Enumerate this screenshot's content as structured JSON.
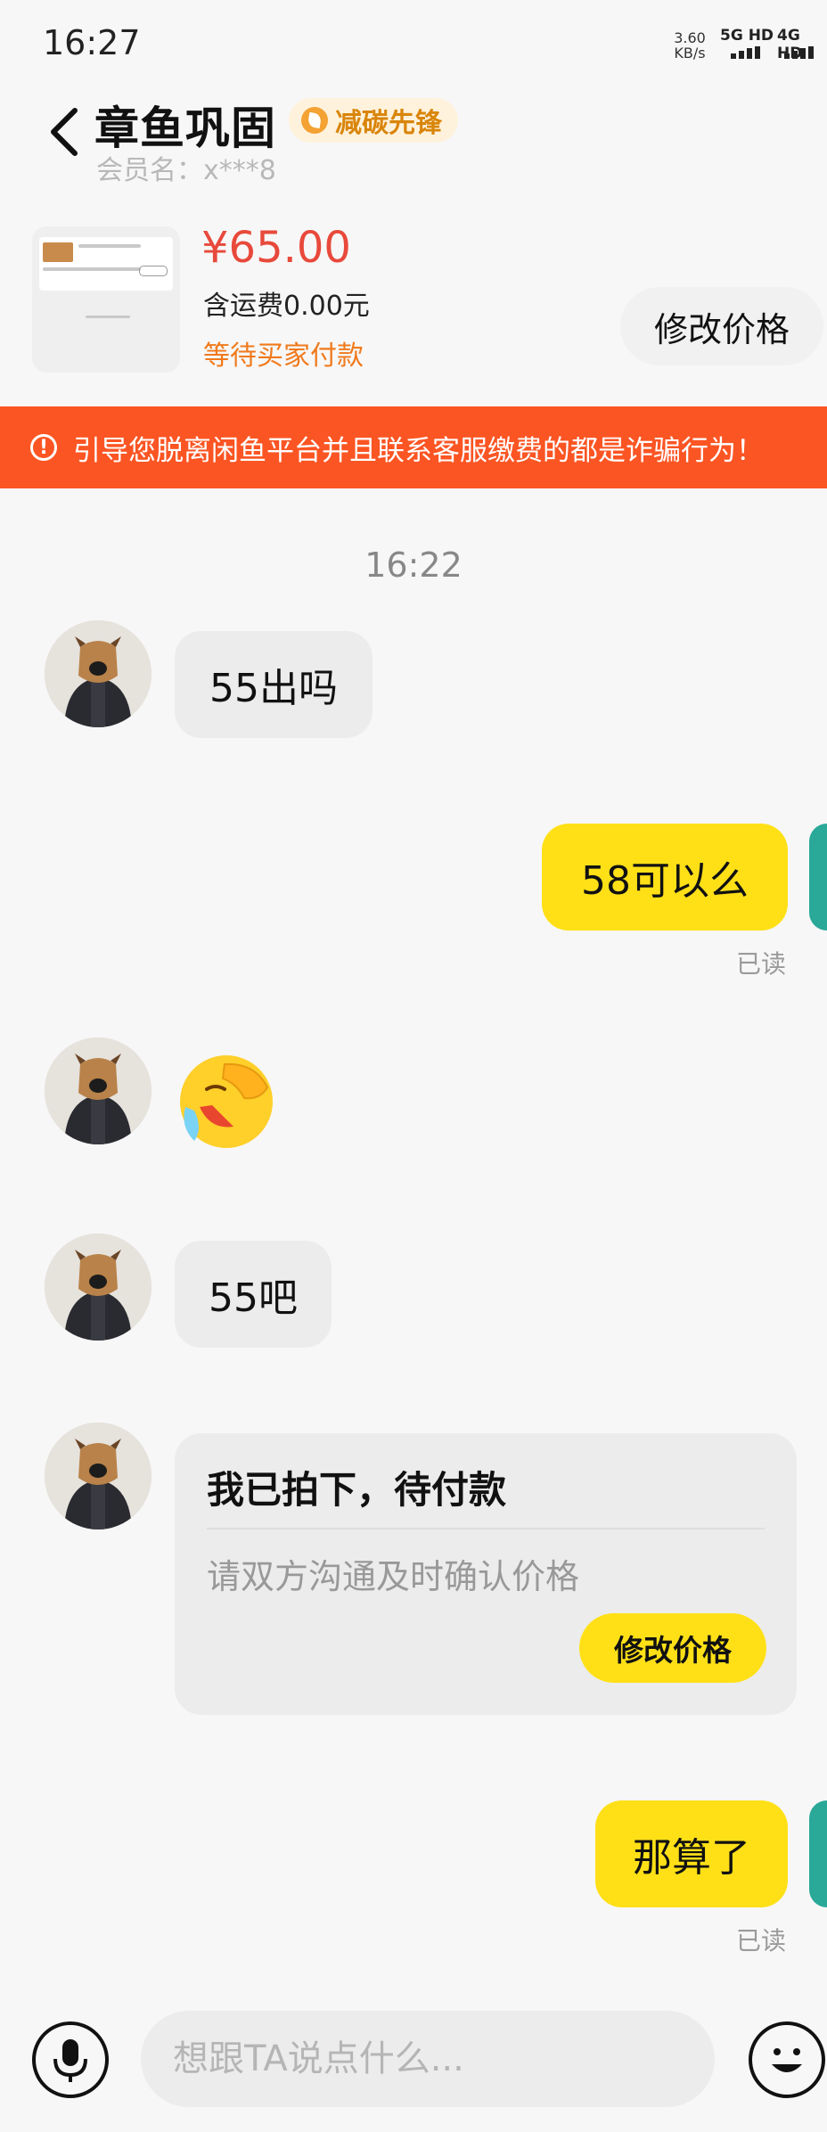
{
  "status_bar": {
    "time": "16:27",
    "net_speed_value": "3.60",
    "net_speed_unit": "KB/s",
    "sim1": "5G HD",
    "sim2": "4G HD"
  },
  "header": {
    "back_icon": "chevron-left-icon",
    "seller_name": "章鱼巩固",
    "badge": "减碳先锋",
    "member_label": "会员名：x***8"
  },
  "product": {
    "price": "¥65.00",
    "shipping": "含运费0.00元",
    "status": "等待买家付款",
    "modify_button": "修改价格"
  },
  "warning": {
    "icon": "alert-circle-icon",
    "text": "引导您脱离闲鱼平台并且联系客服缴费的都是诈骗行为！"
  },
  "chat": {
    "timestamp": "16:22",
    "msg1": "55出吗",
    "msg2": "58可以么",
    "msg2_read": "已读",
    "msg3_emoji": "facepalm-crying-emoji",
    "msg4": "55吧",
    "card": {
      "title": "我已拍下，待付款",
      "subtitle": "请双方沟通及时确认价格",
      "button": "修改价格"
    },
    "msg5": "那算了",
    "msg5_read": "已读"
  },
  "input_bar": {
    "placeholder": "想跟TA说点什么...",
    "voice_icon": "microphone-icon",
    "emoji_icon": "smiley-icon"
  },
  "colors": {
    "accent_yellow": "#ffe017",
    "price_red": "#e8493b",
    "warning_bg": "#fb5523",
    "status_orange": "#f07a1c",
    "badge_text": "#d9850a"
  }
}
